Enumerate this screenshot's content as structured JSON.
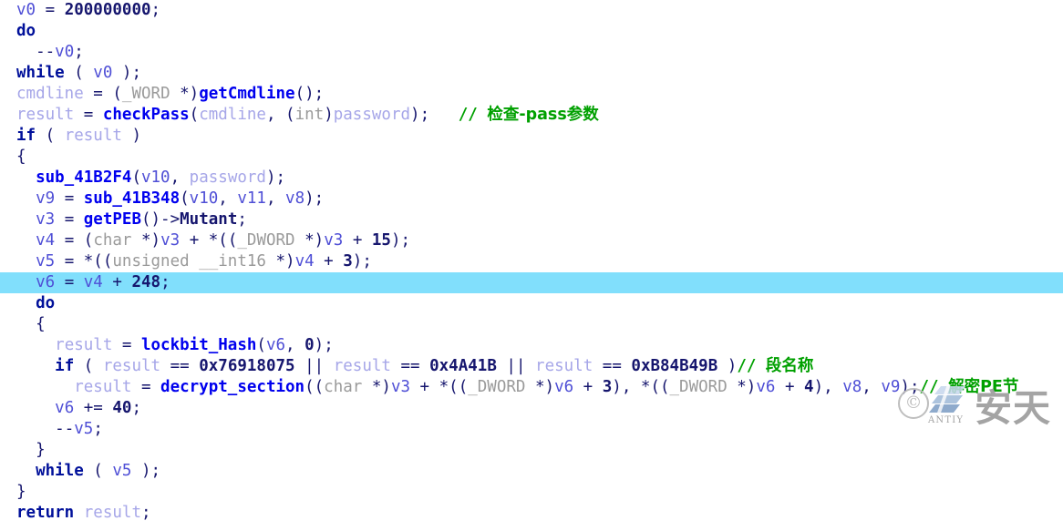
{
  "app": {
    "kind": "decompiler-pseudocode-view",
    "background_color": "#ffffff",
    "highlight_color": "#81dffc"
  },
  "colors": {
    "plain": "#16166e",
    "keyword": "#00109a",
    "variable": "#4f4fd6",
    "light_variable": "#a6a6e8",
    "function": "#0000ee",
    "number": "#16166e",
    "type": "#9a9a9a",
    "comment": "#00a000",
    "highlight_row": "#81dffc",
    "watermark_gray": "#9d9d9d"
  },
  "code": {
    "lines": [
      {
        "indent": 0,
        "highlighted": false,
        "tokens": [
          {
            "k": "var",
            "t": "v0"
          },
          {
            "k": "plain",
            "t": " = "
          },
          {
            "k": "num",
            "t": "200000000"
          },
          {
            "k": "plain",
            "t": ";"
          }
        ]
      },
      {
        "indent": 0,
        "highlighted": false,
        "tokens": [
          {
            "k": "kw",
            "t": "do"
          }
        ]
      },
      {
        "indent": 1,
        "highlighted": false,
        "tokens": [
          {
            "k": "plain",
            "t": "--"
          },
          {
            "k": "var",
            "t": "v0"
          },
          {
            "k": "plain",
            "t": ";"
          }
        ]
      },
      {
        "indent": 0,
        "highlighted": false,
        "tokens": [
          {
            "k": "kw",
            "t": "while"
          },
          {
            "k": "plain",
            "t": " ( "
          },
          {
            "k": "var",
            "t": "v0"
          },
          {
            "k": "plain",
            "t": " );"
          }
        ]
      },
      {
        "indent": 0,
        "highlighted": false,
        "tokens": [
          {
            "k": "lvar",
            "t": "cmdline"
          },
          {
            "k": "plain",
            "t": " = ("
          },
          {
            "k": "type",
            "t": "_WORD"
          },
          {
            "k": "plain",
            "t": " *)"
          },
          {
            "k": "func",
            "t": "getCmdline"
          },
          {
            "k": "plain",
            "t": "();"
          }
        ]
      },
      {
        "indent": 0,
        "highlighted": false,
        "tokens": [
          {
            "k": "lvar",
            "t": "result"
          },
          {
            "k": "plain",
            "t": " = "
          },
          {
            "k": "func",
            "t": "checkPass"
          },
          {
            "k": "plain",
            "t": "("
          },
          {
            "k": "lvar",
            "t": "cmdline"
          },
          {
            "k": "plain",
            "t": ", ("
          },
          {
            "k": "type",
            "t": "int"
          },
          {
            "k": "plain",
            "t": ")"
          },
          {
            "k": "lvar",
            "t": "password"
          },
          {
            "k": "plain",
            "t": ");"
          },
          {
            "k": "plain",
            "t": "   "
          },
          {
            "k": "cmt",
            "t": "// "
          },
          {
            "k": "cmtcjk",
            "t": "检查-pass参数"
          }
        ]
      },
      {
        "indent": 0,
        "highlighted": false,
        "tokens": [
          {
            "k": "kw",
            "t": "if"
          },
          {
            "k": "plain",
            "t": " ( "
          },
          {
            "k": "lvar",
            "t": "result"
          },
          {
            "k": "plain",
            "t": " )"
          }
        ]
      },
      {
        "indent": 0,
        "highlighted": false,
        "tokens": [
          {
            "k": "plain",
            "t": "{"
          }
        ]
      },
      {
        "indent": 1,
        "highlighted": false,
        "tokens": [
          {
            "k": "func",
            "t": "sub_41B2F4"
          },
          {
            "k": "plain",
            "t": "("
          },
          {
            "k": "var",
            "t": "v10"
          },
          {
            "k": "plain",
            "t": ", "
          },
          {
            "k": "lvar",
            "t": "password"
          },
          {
            "k": "plain",
            "t": ");"
          }
        ]
      },
      {
        "indent": 1,
        "highlighted": false,
        "tokens": [
          {
            "k": "var",
            "t": "v9"
          },
          {
            "k": "plain",
            "t": " = "
          },
          {
            "k": "func",
            "t": "sub_41B348"
          },
          {
            "k": "plain",
            "t": "("
          },
          {
            "k": "var",
            "t": "v10"
          },
          {
            "k": "plain",
            "t": ", "
          },
          {
            "k": "var",
            "t": "v11"
          },
          {
            "k": "plain",
            "t": ", "
          },
          {
            "k": "var",
            "t": "v8"
          },
          {
            "k": "plain",
            "t": ");"
          }
        ]
      },
      {
        "indent": 1,
        "highlighted": false,
        "tokens": [
          {
            "k": "var",
            "t": "v3"
          },
          {
            "k": "plain",
            "t": " = "
          },
          {
            "k": "func",
            "t": "getPEB"
          },
          {
            "k": "plain",
            "t": "()->"
          },
          {
            "k": "mem",
            "t": "Mutant"
          },
          {
            "k": "plain",
            "t": ";"
          }
        ]
      },
      {
        "indent": 1,
        "highlighted": false,
        "tokens": [
          {
            "k": "var",
            "t": "v4"
          },
          {
            "k": "plain",
            "t": " = ("
          },
          {
            "k": "type",
            "t": "char"
          },
          {
            "k": "plain",
            "t": " *)"
          },
          {
            "k": "var",
            "t": "v3"
          },
          {
            "k": "plain",
            "t": " + *(("
          },
          {
            "k": "type",
            "t": "_DWORD"
          },
          {
            "k": "plain",
            "t": " *)"
          },
          {
            "k": "var",
            "t": "v3"
          },
          {
            "k": "plain",
            "t": " + "
          },
          {
            "k": "num",
            "t": "15"
          },
          {
            "k": "plain",
            "t": ");"
          }
        ]
      },
      {
        "indent": 1,
        "highlighted": false,
        "tokens": [
          {
            "k": "var",
            "t": "v5"
          },
          {
            "k": "plain",
            "t": " = *(("
          },
          {
            "k": "type",
            "t": "unsigned __int16"
          },
          {
            "k": "plain",
            "t": " *)"
          },
          {
            "k": "var",
            "t": "v4"
          },
          {
            "k": "plain",
            "t": " + "
          },
          {
            "k": "num",
            "t": "3"
          },
          {
            "k": "plain",
            "t": ");"
          }
        ]
      },
      {
        "indent": 1,
        "highlighted": true,
        "tokens": [
          {
            "k": "var",
            "t": "v6"
          },
          {
            "k": "plain",
            "t": " = "
          },
          {
            "k": "var",
            "t": "v4"
          },
          {
            "k": "plain",
            "t": " + "
          },
          {
            "k": "num",
            "t": "248"
          },
          {
            "k": "plain",
            "t": ";"
          }
        ]
      },
      {
        "indent": 1,
        "highlighted": false,
        "tokens": [
          {
            "k": "kw",
            "t": "do"
          }
        ]
      },
      {
        "indent": 1,
        "highlighted": false,
        "tokens": [
          {
            "k": "plain",
            "t": "{"
          }
        ]
      },
      {
        "indent": 2,
        "highlighted": false,
        "tokens": [
          {
            "k": "lvar",
            "t": "result"
          },
          {
            "k": "plain",
            "t": " = "
          },
          {
            "k": "func",
            "t": "lockbit_Hash"
          },
          {
            "k": "plain",
            "t": "("
          },
          {
            "k": "var",
            "t": "v6"
          },
          {
            "k": "plain",
            "t": ", "
          },
          {
            "k": "num",
            "t": "0"
          },
          {
            "k": "plain",
            "t": ");"
          }
        ]
      },
      {
        "indent": 2,
        "highlighted": false,
        "tokens": [
          {
            "k": "kw",
            "t": "if"
          },
          {
            "k": "plain",
            "t": " ( "
          },
          {
            "k": "lvar",
            "t": "result"
          },
          {
            "k": "plain",
            "t": " == "
          },
          {
            "k": "num",
            "t": "0x76918075"
          },
          {
            "k": "plain",
            "t": " || "
          },
          {
            "k": "lvar",
            "t": "result"
          },
          {
            "k": "plain",
            "t": " == "
          },
          {
            "k": "num",
            "t": "0x4A41B"
          },
          {
            "k": "plain",
            "t": " || "
          },
          {
            "k": "lvar",
            "t": "result"
          },
          {
            "k": "plain",
            "t": " == "
          },
          {
            "k": "num",
            "t": "0xB84B49B"
          },
          {
            "k": "plain",
            "t": " )"
          },
          {
            "k": "cmt",
            "t": "// "
          },
          {
            "k": "cmtcjk",
            "t": "段名称"
          }
        ]
      },
      {
        "indent": 3,
        "highlighted": false,
        "tokens": [
          {
            "k": "lvar",
            "t": "result"
          },
          {
            "k": "plain",
            "t": " = "
          },
          {
            "k": "func",
            "t": "decrypt_section"
          },
          {
            "k": "plain",
            "t": "(("
          },
          {
            "k": "type",
            "t": "char"
          },
          {
            "k": "plain",
            "t": " *)"
          },
          {
            "k": "var",
            "t": "v3"
          },
          {
            "k": "plain",
            "t": " + *(("
          },
          {
            "k": "type",
            "t": "_DWORD"
          },
          {
            "k": "plain",
            "t": " *)"
          },
          {
            "k": "var",
            "t": "v6"
          },
          {
            "k": "plain",
            "t": " + "
          },
          {
            "k": "num",
            "t": "3"
          },
          {
            "k": "plain",
            "t": "), *(("
          },
          {
            "k": "type",
            "t": "_DWORD"
          },
          {
            "k": "plain",
            "t": " *)"
          },
          {
            "k": "var",
            "t": "v6"
          },
          {
            "k": "plain",
            "t": " + "
          },
          {
            "k": "num",
            "t": "4"
          },
          {
            "k": "plain",
            "t": "), "
          },
          {
            "k": "var",
            "t": "v8"
          },
          {
            "k": "plain",
            "t": ", "
          },
          {
            "k": "var",
            "t": "v9"
          },
          {
            "k": "plain",
            "t": ");"
          },
          {
            "k": "cmt",
            "t": "// "
          },
          {
            "k": "cmtcjk",
            "t": "解密PE节"
          }
        ]
      },
      {
        "indent": 2,
        "highlighted": false,
        "tokens": [
          {
            "k": "var",
            "t": "v6"
          },
          {
            "k": "plain",
            "t": " += "
          },
          {
            "k": "num",
            "t": "40"
          },
          {
            "k": "plain",
            "t": ";"
          }
        ]
      },
      {
        "indent": 2,
        "highlighted": false,
        "tokens": [
          {
            "k": "plain",
            "t": "--"
          },
          {
            "k": "var",
            "t": "v5"
          },
          {
            "k": "plain",
            "t": ";"
          }
        ]
      },
      {
        "indent": 1,
        "highlighted": false,
        "tokens": [
          {
            "k": "plain",
            "t": "}"
          }
        ]
      },
      {
        "indent": 1,
        "highlighted": false,
        "tokens": [
          {
            "k": "kw",
            "t": "while"
          },
          {
            "k": "plain",
            "t": " ( "
          },
          {
            "k": "var",
            "t": "v5"
          },
          {
            "k": "plain",
            "t": " );"
          }
        ]
      },
      {
        "indent": 0,
        "highlighted": false,
        "tokens": [
          {
            "k": "plain",
            "t": "}"
          }
        ]
      },
      {
        "indent": 0,
        "highlighted": false,
        "tokens": [
          {
            "k": "kw",
            "t": "return"
          },
          {
            "k": "plain",
            "t": " "
          },
          {
            "k": "lvar",
            "t": "result"
          },
          {
            "k": "plain",
            "t": ";"
          }
        ]
      }
    ]
  },
  "watermark": {
    "copyright_symbol": "©",
    "brand_latin": "ANTIY",
    "brand_cjk": "安天"
  }
}
